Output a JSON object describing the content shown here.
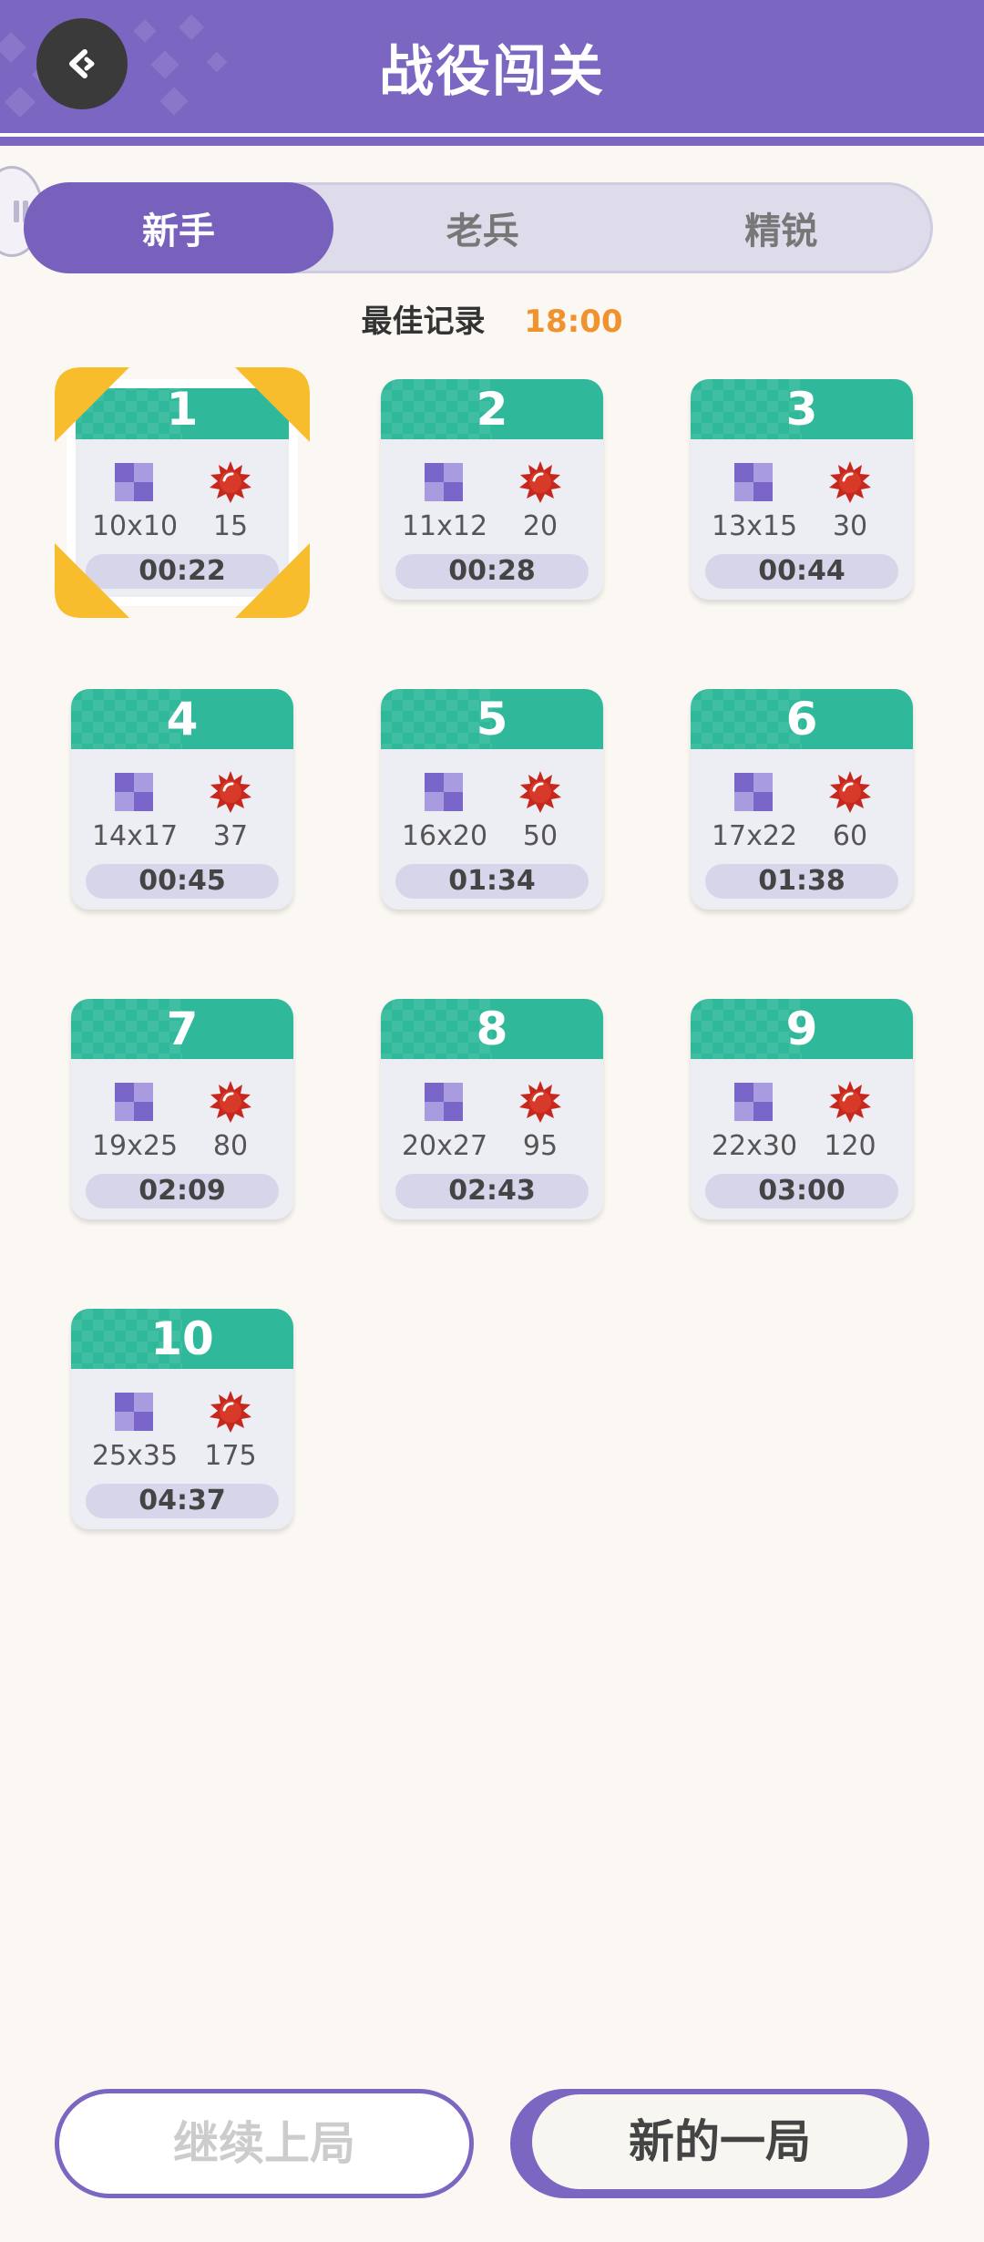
{
  "header": {
    "title": "战役闯关"
  },
  "tabs": [
    {
      "label": "新手",
      "active": true
    },
    {
      "label": "老兵",
      "active": false
    },
    {
      "label": "精锐",
      "active": false
    }
  ],
  "best_record": {
    "label": "最佳记录",
    "value": "18:00"
  },
  "levels": [
    {
      "num": "1",
      "size": "10x10",
      "mines": "15",
      "time": "00:22",
      "selected": true
    },
    {
      "num": "2",
      "size": "11x12",
      "mines": "20",
      "time": "00:28"
    },
    {
      "num": "3",
      "size": "13x15",
      "mines": "30",
      "time": "00:44"
    },
    {
      "num": "4",
      "size": "14x17",
      "mines": "37",
      "time": "00:45"
    },
    {
      "num": "5",
      "size": "16x20",
      "mines": "50",
      "time": "01:34"
    },
    {
      "num": "6",
      "size": "17x22",
      "mines": "60",
      "time": "01:38"
    },
    {
      "num": "7",
      "size": "19x25",
      "mines": "80",
      "time": "02:09"
    },
    {
      "num": "8",
      "size": "20x27",
      "mines": "95",
      "time": "02:43"
    },
    {
      "num": "9",
      "size": "22x30",
      "mines": "120",
      "time": "03:00"
    },
    {
      "num": "10",
      "size": "25x35",
      "mines": "175",
      "time": "04:37"
    }
  ],
  "buttons": {
    "continue": "继续上局",
    "new_game": "新的一局"
  },
  "colors": {
    "header": "#7b66c1",
    "card_head": "#2fb99a",
    "best_value": "#f0922e",
    "selected_corner": "#f7bd2d"
  },
  "icons": {
    "back": "back-arrow-icon",
    "grid": "grid-icon",
    "mine": "mine-icon"
  }
}
